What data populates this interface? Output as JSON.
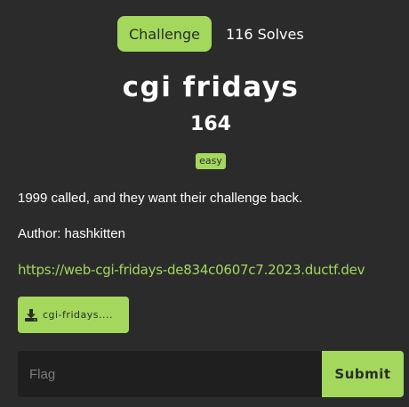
{
  "tabs": {
    "challenge_label": "Challenge",
    "solves_label": "116 Solves"
  },
  "challenge": {
    "name": "cgi fridays",
    "points": "164",
    "difficulty": "easy",
    "description": "1999 called, and they want their challenge back.",
    "author": "Author: hashkitten",
    "url": "https://web-cgi-fridays-de834c0607c7.2023.ductf.dev",
    "file_label": "cgi-fridays...."
  },
  "submission": {
    "placeholder": "Flag",
    "submit_label": "Submit"
  },
  "colors": {
    "accent": "#a3d85d",
    "background": "#2b2b2b",
    "input_background": "#1f1f1f"
  }
}
